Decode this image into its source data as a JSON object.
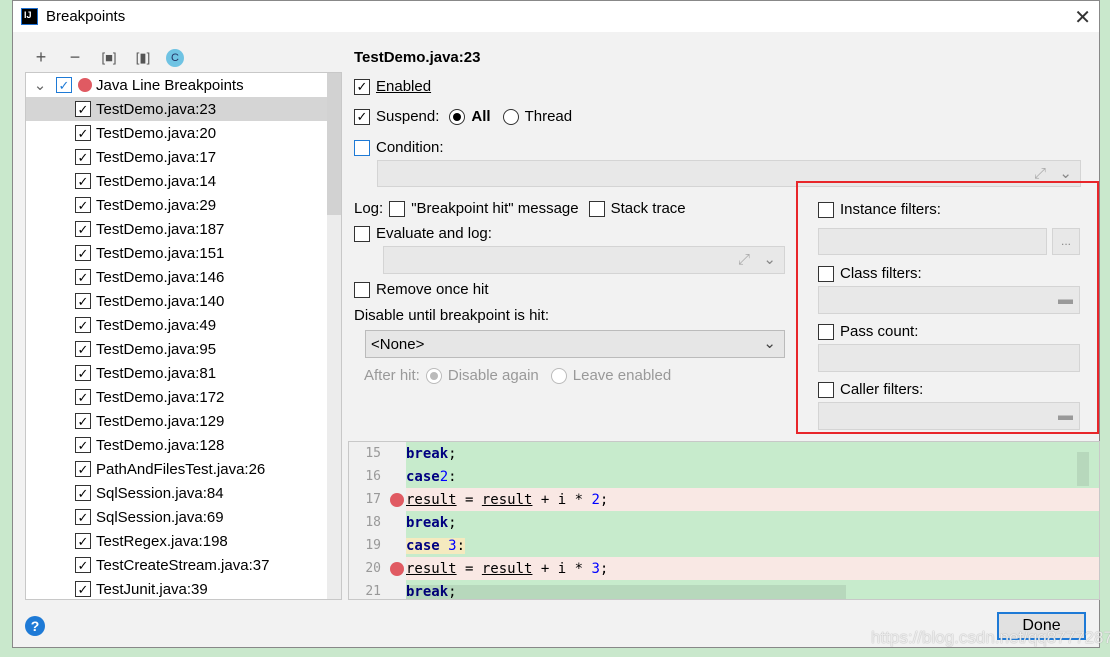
{
  "window": {
    "title": "Breakpoints"
  },
  "toolbar": {
    "add": "+",
    "remove": "−",
    "group_package": "[■]",
    "group_file": "[▮]",
    "group_class": "C"
  },
  "tree": {
    "group_label": "Java Line Breakpoints",
    "items": [
      "TestDemo.java:23",
      "TestDemo.java:20",
      "TestDemo.java:17",
      "TestDemo.java:14",
      "TestDemo.java:29",
      "TestDemo.java:187",
      "TestDemo.java:151",
      "TestDemo.java:146",
      "TestDemo.java:140",
      "TestDemo.java:49",
      "TestDemo.java:95",
      "TestDemo.java:81",
      "TestDemo.java:172",
      "TestDemo.java:129",
      "TestDemo.java:128",
      "PathAndFilesTest.java:26",
      "SqlSession.java:84",
      "SqlSession.java:69",
      "TestRegex.java:198",
      "TestCreateStream.java:37",
      "TestJunit.java:39"
    ]
  },
  "details": {
    "title": "TestDemo.java:23",
    "enabled": "Enabled",
    "suspend": "Suspend:",
    "all": "All",
    "thread": "Thread",
    "condition": "Condition:",
    "log": "Log:",
    "bp_hit": "\"Breakpoint hit\" message",
    "stack_trace": "Stack trace",
    "evaluate_log": "Evaluate and log:",
    "remove_once": "Remove once hit",
    "disable_until": "Disable until breakpoint is hit:",
    "disable_select": "<None>",
    "after_hit": "After hit:",
    "disable_again": "Disable again",
    "leave_enabled": "Leave enabled"
  },
  "filters": {
    "instance": "Instance filters:",
    "instance_btn": "...",
    "class": "Class filters:",
    "pass": "Pass count:",
    "caller": "Caller filters:"
  },
  "editor": {
    "lines": [
      "15",
      "16",
      "17",
      "18",
      "19",
      "20",
      "21"
    ]
  },
  "footer": {
    "done": "Done",
    "help": "?"
  },
  "watermark": "https://blog.csdn.net/qq877728715",
  "colors": {
    "breakpoint": "#e05a62",
    "highlight_box": "#e8262a",
    "accent": "#1e7ad6"
  }
}
